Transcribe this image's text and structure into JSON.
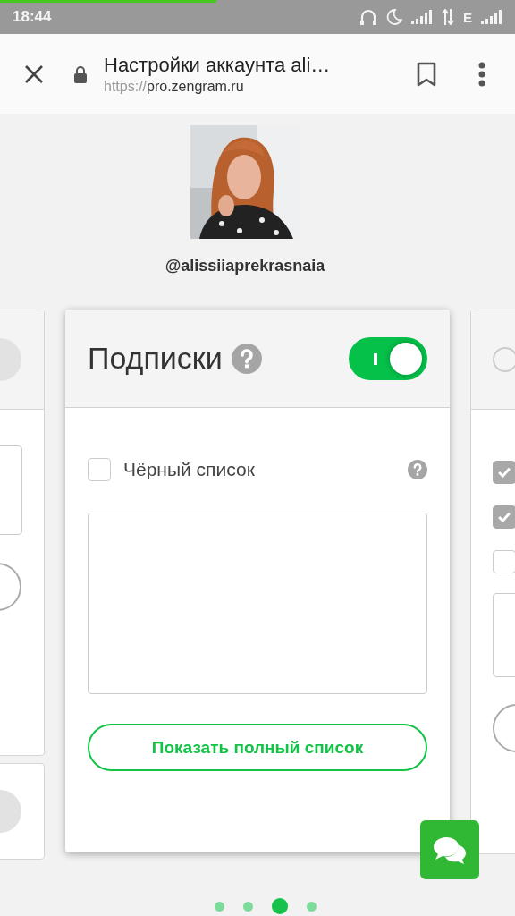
{
  "status_bar": {
    "time": "18:44",
    "network": "E"
  },
  "browser": {
    "progress": {
      "level": 0.42
    },
    "title": "Настройки аккаунта ali…",
    "url_scheme": "https://",
    "url_host": "pro.zengram.ru"
  },
  "profile": {
    "username": "@alissiiaprekrasnaia"
  },
  "left_card": {
    "enabled": false,
    "radio_selected": false
  },
  "left_card_2": {
    "enabled": false
  },
  "card": {
    "title": "Подписки",
    "enabled": true,
    "blacklist": {
      "label": "Чёрный список",
      "checked": false
    },
    "button": "Показать полный список"
  },
  "right_card": {
    "enabled": false,
    "radio_selected": false,
    "checkboxes": [
      {
        "checked": true
      },
      {
        "checked": true
      },
      {
        "checked": false
      }
    ]
  },
  "pagination": [
    {
      "selected": false
    },
    {
      "selected": false
    },
    {
      "selected": true
    },
    {
      "selected": false
    }
  ]
}
